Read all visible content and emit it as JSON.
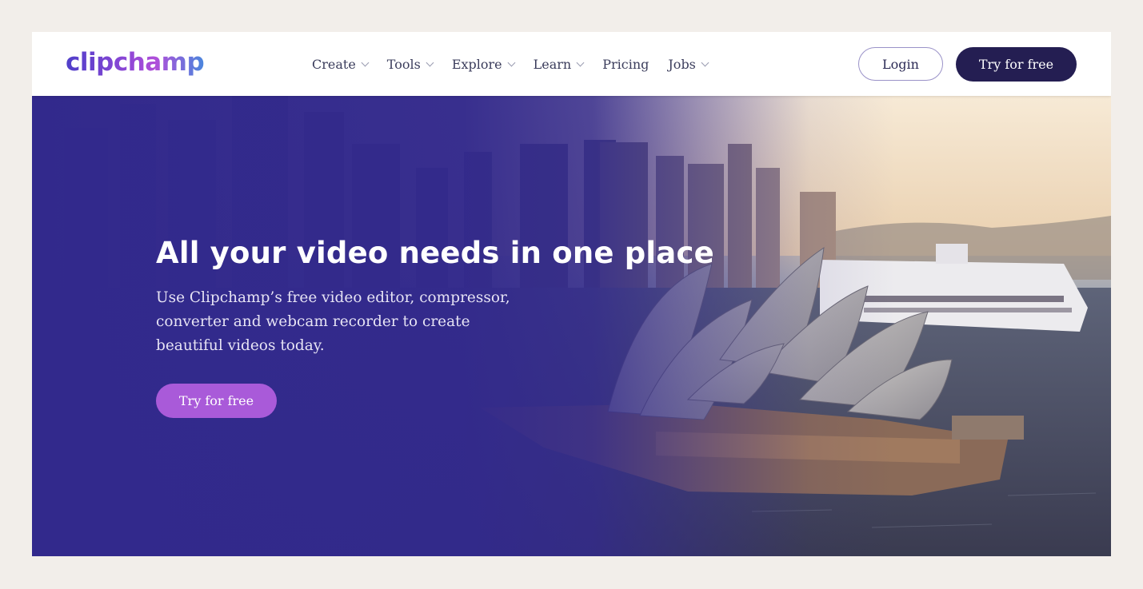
{
  "header": {
    "logo_text": "clipchamp",
    "nav": [
      {
        "label": "Create",
        "has_dropdown": true
      },
      {
        "label": "Tools",
        "has_dropdown": true
      },
      {
        "label": "Explore",
        "has_dropdown": true
      },
      {
        "label": "Learn",
        "has_dropdown": true
      },
      {
        "label": "Pricing",
        "has_dropdown": false
      },
      {
        "label": "Jobs",
        "has_dropdown": true
      }
    ],
    "login_label": "Login",
    "try_label": "Try for free"
  },
  "hero": {
    "headline": "All your video needs in one place",
    "subtext": "Use Clipchamp’s free video editor, compressor, converter and webcam recorder to create beautiful videos today.",
    "cta_label": "Try for free",
    "background_image": "sydney-opera-house-harbour-photo"
  },
  "colors": {
    "page_bg": "#f2eeea",
    "nav_text": "#3b3d5c",
    "primary_dark": "#241e52",
    "accent_purple": "#a95ad9",
    "hero_overlay": "#32298c"
  }
}
